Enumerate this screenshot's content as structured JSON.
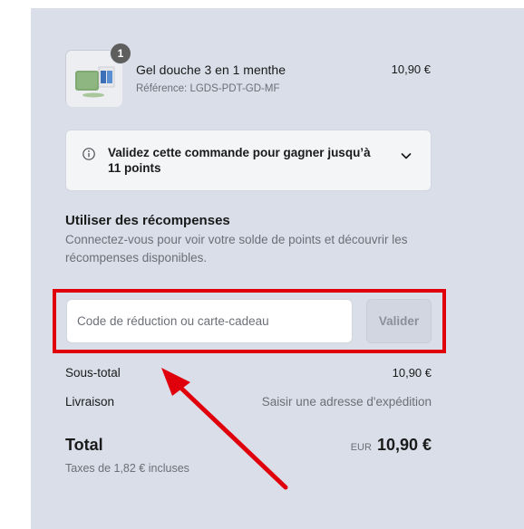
{
  "cart": {
    "item": {
      "quantity": "1",
      "name": "Gel douche 3 en 1 menthe",
      "reference": "Référence: LGDS-PDT-GD-MF",
      "price": "10,90 €"
    }
  },
  "loyalty": {
    "message": "Validez cette commande pour gagner jusqu’à 11 points"
  },
  "rewards": {
    "title": "Utiliser des récompenses",
    "description": "Connectez-vous pour voir votre solde de points et découvrir les récompenses disponibles."
  },
  "discount": {
    "placeholder": "Code de réduction ou carte-cadeau",
    "value": "",
    "apply_label": "Valider"
  },
  "totals": {
    "subtotal_label": "Sous-total",
    "subtotal_value": "10,90 €",
    "shipping_label": "Livraison",
    "shipping_value": "Saisir une adresse d'expédition",
    "total_label": "Total",
    "currency": "EUR",
    "total_value": "10,90 €",
    "taxes": "Taxes de 1,82 € incluses"
  },
  "icons": {
    "info": "info-circle-icon",
    "expand": "chevron-down-icon"
  },
  "colors": {
    "summary_background": "#d9dee9",
    "annotation_red": "#e0000b",
    "quantity_badge": "#5e5e5e"
  }
}
